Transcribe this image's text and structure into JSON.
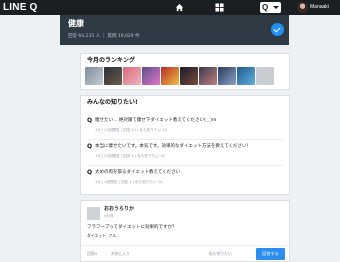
{
  "topbar": {
    "logo": "LINE Q",
    "user_name": "Manaaki",
    "search_label": "Q",
    "icons": [
      "home-icon",
      "grid-icon",
      "chevron-down-icon"
    ]
  },
  "category": {
    "title": "健康",
    "stats": "回答 64,235 人 ｜ 質問 19,029 件"
  },
  "ranking": {
    "title": "今月のランキング"
  },
  "questions": {
    "title": "みんなの知りたい!",
    "items": [
      {
        "text": "痩せたい… 絶対寝て痩せ下ダイエット教えてください(＿)m",
        "meta": "1分 | 13回閲覧 | 回答 11 | 私も知りたい 10"
      },
      {
        "text": "本当に痩せたいです。本気です。効果的なダイエット方法を教えてください！",
        "meta": "1分 | 13回閲覧 | 回答 2 | 私も知りたい 14"
      },
      {
        "text": "太めの肉を取るダイエット教えてください",
        "meta": "1分 | 4回閲覧 | 回答 1 | 私も知りたい 14"
      }
    ]
  },
  "card": {
    "name": "おおうらりか",
    "sub": "4分前",
    "body": "フラフープってダイエットに効果的ですか？",
    "tag": "ダイエット, フル...",
    "footer_left": "回答0",
    "footer_mid": "お気に入り",
    "footer_right": "私も知りたい",
    "answer_label": "回答する"
  },
  "colors": {
    "topbar": "#1a1f24",
    "header": "#2f3a44",
    "accent": "#2d8ef0"
  }
}
